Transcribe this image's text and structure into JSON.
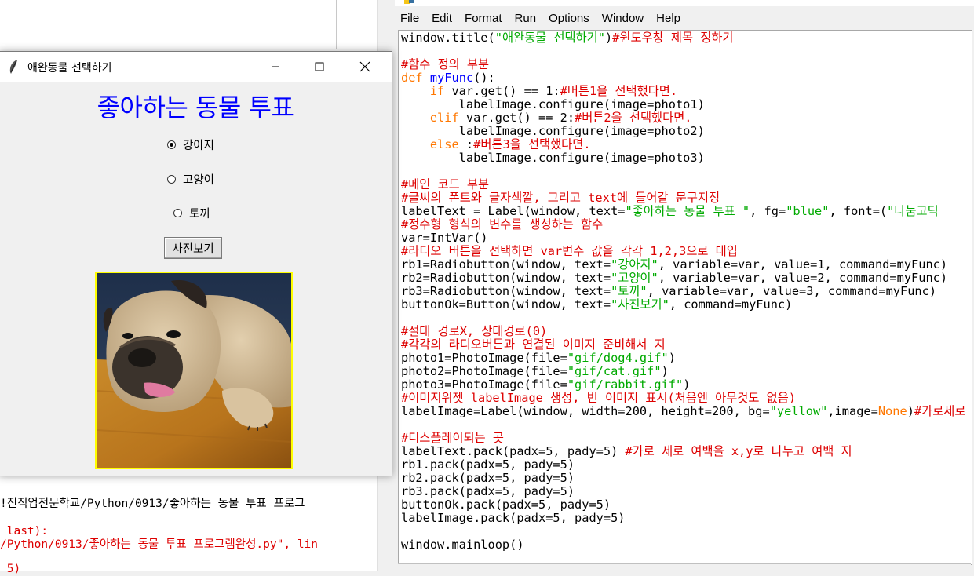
{
  "shell": {
    "lines": [
      "!진직업전문학교/Python/0913/좋아하는 동물 투표 프로그",
      " last):",
      "/Python/0913/좋아하는 동물 투표 프로그램완성.py\", lin",
      " 5)"
    ]
  },
  "editor": {
    "menu": [
      "File",
      "Edit",
      "Format",
      "Run",
      "Options",
      "Window",
      "Help"
    ],
    "code_lines": [
      "window.title(\"애완동물 선택하기\")#윈도우창 제목 정하기",
      "",
      "#함수 정의 부분",
      "def myFunc():",
      "    if var.get() == 1:#버튼1을 선택했다면.",
      "        labelImage.configure(image=photo1)",
      "    elif var.get() == 2:#버튼2을 선택했다면.",
      "        labelImage.configure(image=photo2)",
      "    else :#버튼3을 선택했다면.",
      "        labelImage.configure(image=photo3)",
      "",
      "#메인 코드 부분",
      "#글씨의 폰트와 글자색깔, 그리고 text에 들어갈 문구지정",
      "labelText = Label(window, text=\"좋아하는 동물 투표 \", fg=\"blue\", font=(\"나눔고딕",
      "#정수형 형식의 변수를 생성하는 함수",
      "var=IntVar()",
      "#라디오 버튼을 선택하면 var변수 값을 각각 1,2,3으로 대입",
      "rb1=Radiobutton(window, text=\"강아지\", variable=var, value=1, command=myFunc)",
      "rb2=Radiobutton(window, text=\"고양이\", variable=var, value=2, command=myFunc)",
      "rb3=Radiobutton(window, text=\"토끼\", variable=var, value=3, command=myFunc)",
      "buttonOk=Button(window, text=\"사진보기\", command=myFunc)",
      "",
      "#절대 경로X, 상대경로(0)",
      "#각각의 라디오버튼과 연결된 이미지 준비해서 지",
      "photo1=PhotoImage(file=\"gif/dog4.gif\")",
      "photo2=PhotoImage(file=\"gif/cat.gif\")",
      "photo3=PhotoImage(file=\"gif/rabbit.gif\")",
      "#이미지위젯 labelImage 생성, 빈 이미지 표시(처음엔 아무것도 없음)",
      "labelImage=Label(window, width=200, height=200, bg=\"yellow\",image=None)#가로세로",
      "",
      "#디스플레이되는 곳",
      "labelText.pack(padx=5, pady=5) #가로 세로 여백을 x,y로 나누고 여백 지",
      "rb1.pack(padx=5, pady=5)",
      "rb2.pack(padx=5, pady=5)",
      "rb3.pack(padx=5, pady=5)",
      "buttonOk.pack(padx=5, pady=5)",
      "labelImage.pack(padx=5, pady=5)",
      "",
      "window.mainloop()"
    ]
  },
  "tk_window": {
    "title": "애완동물 선택하기",
    "heading": "좋아하는 동물 투표",
    "heading_color": "#0000ff",
    "radios": [
      {
        "label": "강아지",
        "checked": true
      },
      {
        "label": "고양이",
        "checked": false
      },
      {
        "label": "토끼",
        "checked": false
      }
    ],
    "button_label": "사진보기",
    "image_bg": "#ffff00",
    "image_subject": "pug lying on a wooden floor"
  },
  "colors": {
    "comment": "#dd0000",
    "keyword": "#ff7700",
    "string": "#00aa00",
    "defname": "#0000ff"
  }
}
